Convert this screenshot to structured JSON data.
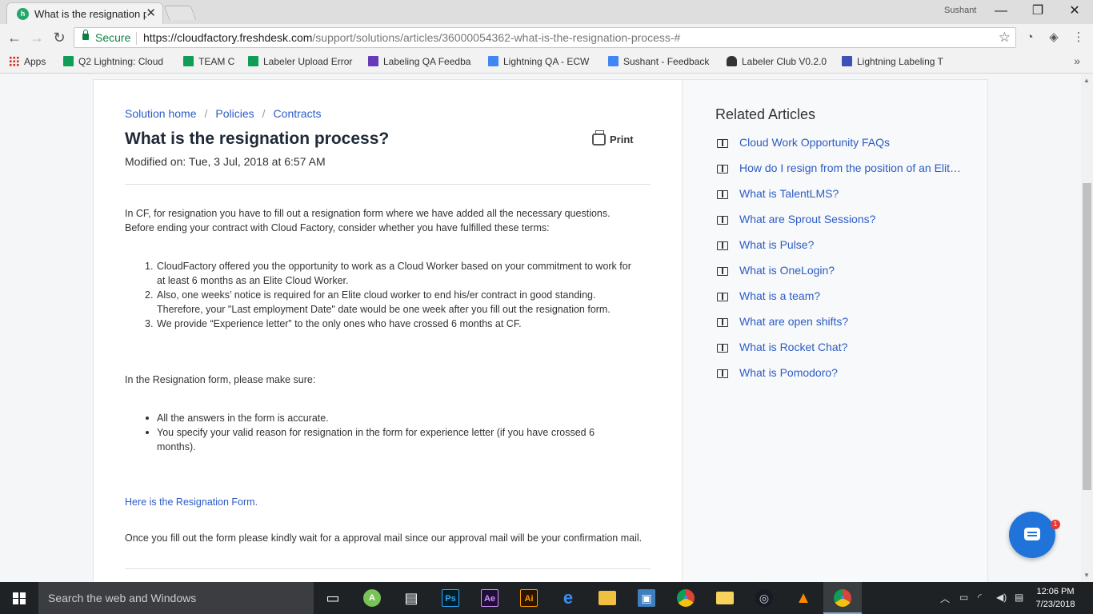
{
  "browser": {
    "tab_title": "What is the resignation p",
    "tab_close": "✕",
    "profile_name": "Sushant",
    "window_buttons": {
      "minimize": "—",
      "maximize": "❐",
      "close": "✕"
    },
    "secure_label": "Secure",
    "url_host": "https://cloudfactory.freshdesk.com",
    "url_path": "/support/solutions/articles/36000054362-what-is-the-resignation-process-#",
    "bookmarks": [
      {
        "label": "Apps",
        "icon": "apps-grid-icon"
      },
      {
        "label": "Q2 Lightning: Cloud",
        "icon": "sheets-icon",
        "color": "#0f9d58"
      },
      {
        "label": "TEAM C",
        "icon": "sheets-icon",
        "color": "#0f9d58"
      },
      {
        "label": "Labeler Upload Error",
        "icon": "sheets-icon",
        "color": "#0f9d58"
      },
      {
        "label": "Labeling QA Feedba",
        "icon": "forms-icon",
        "color": "#673ab7"
      },
      {
        "label": "Lightning QA - ECW",
        "icon": "docs-icon",
        "color": "#4285f4"
      },
      {
        "label": "Sushant - Feedback",
        "icon": "docs-icon",
        "color": "#4285f4"
      },
      {
        "label": "Labeler Club V0.2.0",
        "icon": "car-icon",
        "color": "#333333"
      },
      {
        "label": "Lightning Labeling T",
        "icon": "slides-icon",
        "color": "#3f51b5"
      }
    ],
    "bookmarks_more": "»"
  },
  "article": {
    "breadcrumb": [
      "Solution home",
      "Policies",
      "Contracts"
    ],
    "title": "What is the resignation process?",
    "print_label": "Print",
    "modified": "Modified on: Tue, 3 Jul, 2018 at 6:57 AM",
    "intro": "In CF, for resignation you have to fill out a resignation form where we have added all the necessary questions. Before ending your contract with Cloud Factory, consider whether you have fulfilled these terms:",
    "terms": [
      {
        "num": "1.",
        "text": " CloudFactory offered you the opportunity to work as a Cloud Worker based on your commitment to work for at least 6 months as an Elite Cloud Worker."
      },
      {
        "num": "2.",
        "text": "Also, one weeks’ notice is required for an Elite cloud worker to end his/er contract in good standing. Therefore, your \"Last employment Date\" date would be one week after you fill out the resignation form."
      },
      {
        "num": "3.",
        "text": "We provide “Experience letter” to the only ones who have crossed 6 months at CF."
      }
    ],
    "form_intro": "In the Resignation form, please make sure:",
    "checklist": [
      "All the answers in the form is accurate.",
      "You specify your valid reason for resignation in the form for experience letter (if you have crossed 6 months)."
    ],
    "form_link": "Here is the Resignation Form.",
    "closing": "Once you fill out the form please kindly wait for a approval mail since our approval mail will be your confirmation mail."
  },
  "related": {
    "title": "Related Articles",
    "items": [
      "Cloud Work Opportunity FAQs",
      "How do I resign from the position of an Elite Cloud Worker?",
      "What is TalentLMS?",
      "What are Sprout Sessions?",
      "What is Pulse?",
      "What is OneLogin?",
      "What is a team?",
      "What are open shifts?",
      "What is Rocket Chat?",
      "What is Pomodoro?"
    ]
  },
  "chat": {
    "badge": "1"
  },
  "taskbar": {
    "search_placeholder": "Search the web and Windows",
    "apps": [
      {
        "name": "task-view",
        "glyph": "▭",
        "color": "#1f2225"
      },
      {
        "name": "android-studio",
        "glyph": "A",
        "color": "#78c257"
      },
      {
        "name": "store",
        "glyph": "▤",
        "color": "#1f2225"
      },
      {
        "name": "photoshop",
        "glyph": "Ps",
        "color": "#001d26"
      },
      {
        "name": "after-effects",
        "glyph": "Ae",
        "color": "#1f0f38"
      },
      {
        "name": "illustrator",
        "glyph": "Ai",
        "color": "#2b1500"
      },
      {
        "name": "edge",
        "glyph": "e",
        "color": "#1f2225"
      },
      {
        "name": "file-explorer",
        "glyph": "▬",
        "color": "#f0c040"
      },
      {
        "name": "app-box",
        "glyph": "▣",
        "color": "#3f7fbf"
      },
      {
        "name": "chrome",
        "glyph": "●",
        "color": "#1f2225"
      },
      {
        "name": "folder",
        "glyph": "▬",
        "color": "#f7d35c"
      },
      {
        "name": "steam",
        "glyph": "◎",
        "color": "#1f2225"
      },
      {
        "name": "vlc",
        "glyph": "▲",
        "color": "#1f2225"
      },
      {
        "name": "chrome-profile",
        "glyph": "●",
        "color": "#3a3d40"
      }
    ],
    "time": "12:06 PM",
    "date": "7/23/2018"
  }
}
